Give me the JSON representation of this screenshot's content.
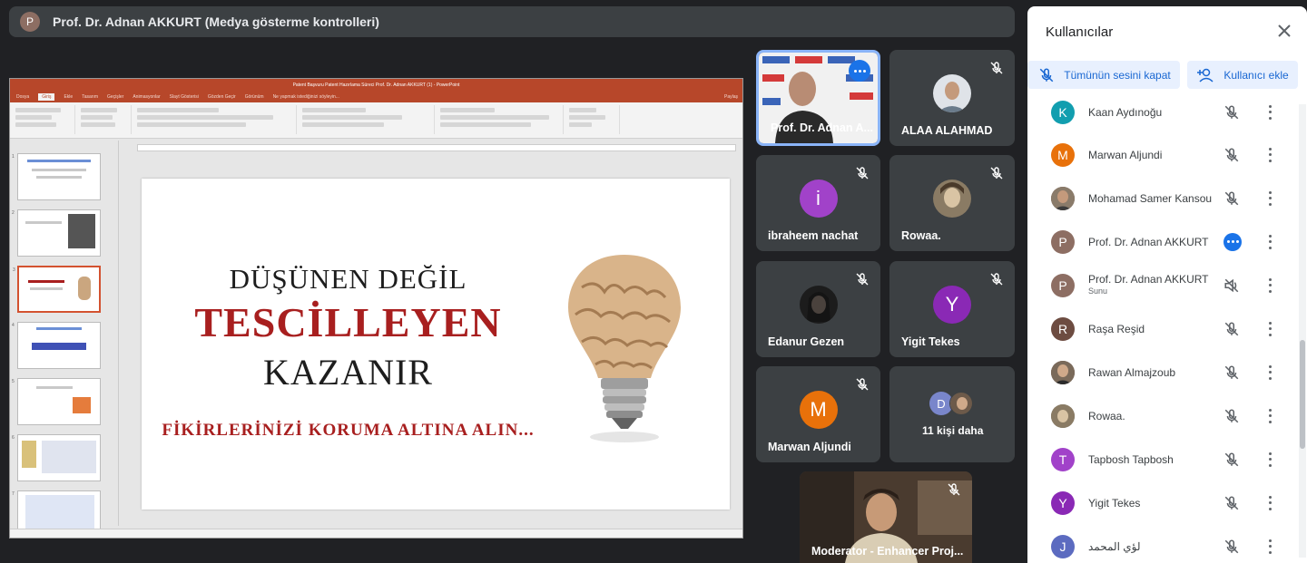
{
  "banner": {
    "avatar_letter": "P",
    "text": "Prof. Dr. Adnan AKKURT (Medya gösterme kontrolleri)"
  },
  "presentation": {
    "window_title": "Patent Başvuru Patent Hazırlama Süreci Prof. Dr. Adnan AKKURT (1) - PowerPoint",
    "tabs": [
      "Dosya",
      "Giriş",
      "Ekle",
      "Tasarım",
      "Geçişler",
      "Animasyonlar",
      "Slayt Gösterisi",
      "Gözden Geçir",
      "Görünüm",
      "Ne yapmak istediğinizi söyleyin..."
    ],
    "share_label": "Paylaş",
    "slide": {
      "line1": "DÜŞÜNEN DEĞİL",
      "line2": "TESCİLLEYEN",
      "line3": "KAZANIR",
      "line4": "FİKİRLERİNİZİ KORUMA ALTINA ALIN..."
    },
    "thumb_numbers": [
      "1",
      "2",
      "3",
      "4",
      "5",
      "6",
      "7"
    ]
  },
  "tiles": [
    {
      "name": "Prof. Dr. Adnan A...",
      "kind": "video",
      "speaking": true
    },
    {
      "name": "ALAA ALAHMAD",
      "kind": "photo",
      "muted": false
    },
    {
      "name": "ibraheem nachat",
      "kind": "letter",
      "letter": "i",
      "color": "#a142c9",
      "muted": true
    },
    {
      "name": "Rowaa.",
      "kind": "photo",
      "muted": true
    },
    {
      "name": "Edanur Gezen",
      "kind": "photo",
      "muted": true
    },
    {
      "name": "Yigit Tekes",
      "kind": "letter",
      "letter": "Y",
      "color": "#8a29b5",
      "muted": true
    },
    {
      "name": "Marwan Aljundi",
      "kind": "letter",
      "letter": "M",
      "color": "#e8710a",
      "muted": true
    },
    {
      "name": "11 kişi daha",
      "kind": "group",
      "letter": "D"
    },
    {
      "name": "Moderator - Enhancer Proj...",
      "kind": "video",
      "muted": true
    }
  ],
  "panel": {
    "title": "Kullanıcılar",
    "mute_all_label": "Tümünün sesini kapat",
    "add_user_label": "Kullanıcı ekle",
    "participants": [
      {
        "name": "Kaan Aydınoğu",
        "letter": "K",
        "color": "#129eaf",
        "status": "muted"
      },
      {
        "name": "Marwan Aljundi",
        "letter": "M",
        "color": "#e8710a",
        "status": "muted"
      },
      {
        "name": "Mohamad Samer Kansou",
        "letter": "",
        "color": "#6d4c41",
        "status": "muted"
      },
      {
        "name": "Prof. Dr. Adnan AKKURT",
        "letter": "P",
        "color": "#8d6e63",
        "status": "speaking"
      },
      {
        "name": "Prof. Dr. Adnan AKKURT",
        "sub": "Sunu",
        "letter": "P",
        "color": "#8d6e63",
        "status": "presenting"
      },
      {
        "name": "Raşa Reşid",
        "letter": "R",
        "color": "#6d4c41",
        "status": "muted"
      },
      {
        "name": "Rawan Almajzoub",
        "letter": "",
        "color": "#5d4037",
        "status": "muted"
      },
      {
        "name": "Rowaa.",
        "letter": "",
        "color": "#6d6d5d",
        "status": "muted"
      },
      {
        "name": "Tapbosh Tapbosh",
        "letter": "T",
        "color": "#a142c9",
        "status": "muted"
      },
      {
        "name": "Yigit Tekes",
        "letter": "Y",
        "color": "#8a29b5",
        "status": "muted"
      },
      {
        "name": "لؤي المحمد",
        "letter": "J",
        "color": "#5c6bc0",
        "status": "muted"
      }
    ]
  },
  "colors": {
    "meet_bg": "#202124",
    "tile_bg": "#3c4043",
    "accent_blue": "#1a73e8",
    "ppt_red": "#b7472a",
    "slide_red": "#a81f1f"
  }
}
